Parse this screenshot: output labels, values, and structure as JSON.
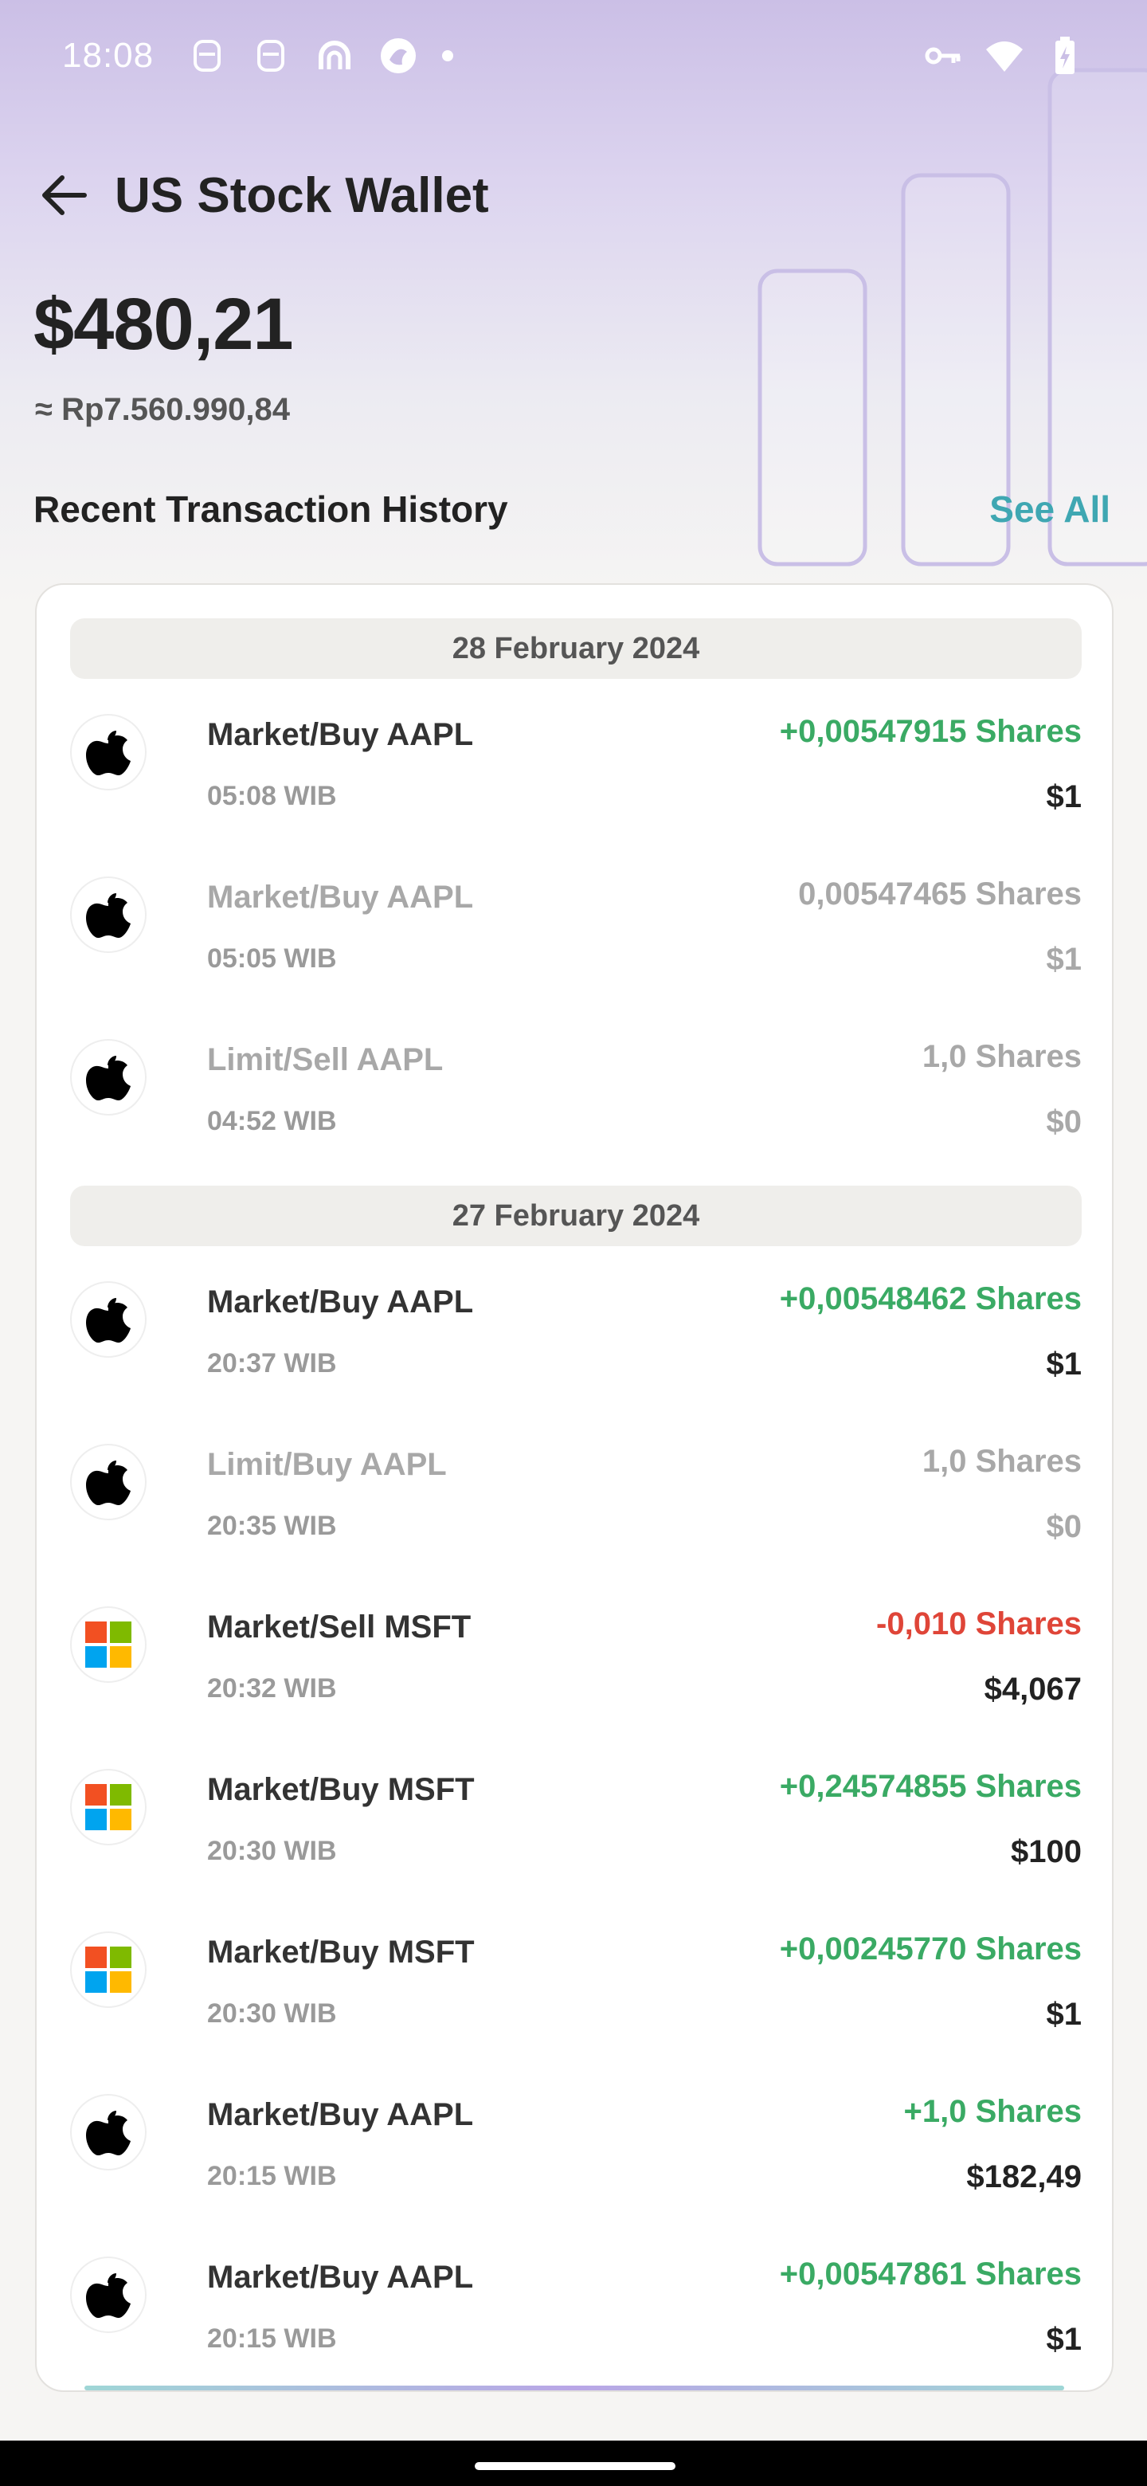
{
  "status_bar": {
    "time": "18:08",
    "left_icons": [
      "notification-icon",
      "notification-icon",
      "app-icon",
      "app-icon",
      "dot-icon"
    ],
    "right_icons": [
      "key-icon",
      "wifi-icon",
      "battery-charging-icon"
    ]
  },
  "header": {
    "back_icon": "arrow-left-icon",
    "title": "US Stock Wallet"
  },
  "balance": {
    "usd": "$480,21",
    "idr": "≈ Rp7.560.990,84"
  },
  "section": {
    "title": "Recent Transaction History",
    "see_all": "See All"
  },
  "groups": [
    {
      "date": "28 February 2024",
      "items": [
        {
          "logo": "apple-logo-icon",
          "title": "Market/Buy AAPL",
          "time": "05:08 WIB",
          "shares": "+0,00547915 Shares",
          "amount": "$1",
          "status": "green"
        },
        {
          "logo": "apple-logo-icon",
          "title": "Market/Buy AAPL",
          "time": "05:05 WIB",
          "shares": "0,00547465 Shares",
          "amount": "$1",
          "status": "muted"
        },
        {
          "logo": "apple-logo-icon",
          "title": "Limit/Sell AAPL",
          "time": "04:52 WIB",
          "shares": "1,0 Shares",
          "amount": "$0",
          "status": "muted"
        }
      ]
    },
    {
      "date": "27 February 2024",
      "items": [
        {
          "logo": "apple-logo-icon",
          "title": "Market/Buy AAPL",
          "time": "20:37 WIB",
          "shares": "+0,00548462 Shares",
          "amount": "$1",
          "status": "green"
        },
        {
          "logo": "apple-logo-icon",
          "title": "Limit/Buy AAPL",
          "time": "20:35 WIB",
          "shares": "1,0 Shares",
          "amount": "$0",
          "status": "muted"
        },
        {
          "logo": "microsoft-logo-icon",
          "title": "Market/Sell MSFT",
          "time": "20:32 WIB",
          "shares": "-0,010 Shares",
          "amount": "$4,067",
          "status": "red"
        },
        {
          "logo": "microsoft-logo-icon",
          "title": "Market/Buy MSFT",
          "time": "20:30 WIB",
          "shares": "+0,24574855 Shares",
          "amount": "$100",
          "status": "green"
        },
        {
          "logo": "microsoft-logo-icon",
          "title": "Market/Buy MSFT",
          "time": "20:30 WIB",
          "shares": "+0,00245770 Shares",
          "amount": "$1",
          "status": "green"
        },
        {
          "logo": "apple-logo-icon",
          "title": "Market/Buy AAPL",
          "time": "20:15 WIB",
          "shares": "+1,0 Shares",
          "amount": "$182,49",
          "status": "green"
        },
        {
          "logo": "apple-logo-icon",
          "title": "Market/Buy AAPL",
          "time": "20:15 WIB",
          "shares": "+0,00547861 Shares",
          "amount": "$1",
          "status": "green"
        }
      ]
    }
  ],
  "colors": {
    "green": "#3aaa64",
    "red": "#df4538",
    "muted": "#a8a8a8",
    "accent": "#3fa7b2"
  }
}
